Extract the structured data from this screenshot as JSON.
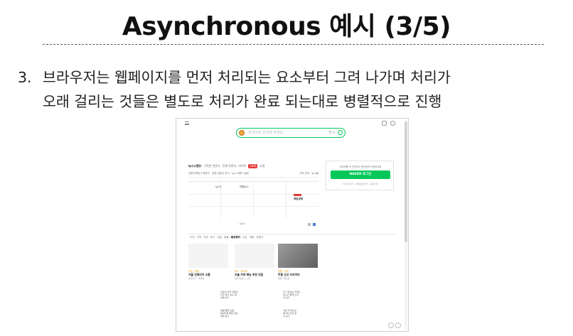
{
  "slide": {
    "title": "Asynchronous 예시 (3/5)",
    "bullet_number": "3.",
    "bullet_line1": "브라우저는 웹페이지를 먼저 처리되는 요소부터 그려 나가며 처리가",
    "bullet_line2": "오래 걸리는 것들은 별도로 처리가 완료 되는대로 병렬적으로 진행"
  },
  "screenshot": {
    "search_placeholder": "검색어를 입력해 주세요.",
    "search_kbd": "한 ▾",
    "news_tabs": [
      "뉴스스탠드",
      "구독한 언론사",
      "전체 언론사",
      "라이브",
      "LIVE",
      "쇼핑"
    ],
    "news_filter_left": "언론사편집 ▾    언론사 · 전체 언론사 보기 · 뉴스스탠드 설정",
    "news_filter_right": "구독 관리 · 뉴스홈",
    "grid_labels": [
      "뉴스1",
      "연합뉴스",
      "매일경제",
      "헤럴드경제"
    ],
    "pager_text": "‹  1/4  ›",
    "login_msg": "네이버를 더 안전하고 편리하게 이용하세요",
    "login_button": "NAVER 로그인",
    "login_links": "아이디 찾기 · 비밀번호 찾기 · 회원가입",
    "categories": [
      "추천",
      "구독",
      "리빙",
      "푸드",
      "게임",
      "동물",
      "패션뷰티",
      "건강",
      "여행",
      "자동차"
    ],
    "cards": [
      {
        "src": "리빙 · 생활",
        "h": "가을 인테리어 소품",
        "s": "집꾸미기 · 추천글"
      },
      {
        "src": "푸드 · 레시피",
        "h": "오늘 저녁 메뉴 추천 모음",
        "s": "요리 블로그 · 인기"
      },
      {
        "src": "여행 · 국내",
        "h": "주말 근교 드라이브",
        "s": "여행 · 베스트"
      }
    ],
    "mini_lists": [
      [
        "오늘의 추천 콘텐츠",
        "지금 많이 보는 글",
        "전체 보기"
      ],
      [
        "인기 급상승 키워드",
        "실시간 화제 소식",
        "더 보기"
      ],
      [
        "생활 꿀팁 모음",
        "알아두면 좋은 정보",
        "전체 보기"
      ],
      [
        "이번 주 베스트",
        "에디터 추천 글",
        "더 보기"
      ]
    ]
  },
  "colors": {
    "naver_green": "#03c75a",
    "live_red": "#e53935"
  }
}
